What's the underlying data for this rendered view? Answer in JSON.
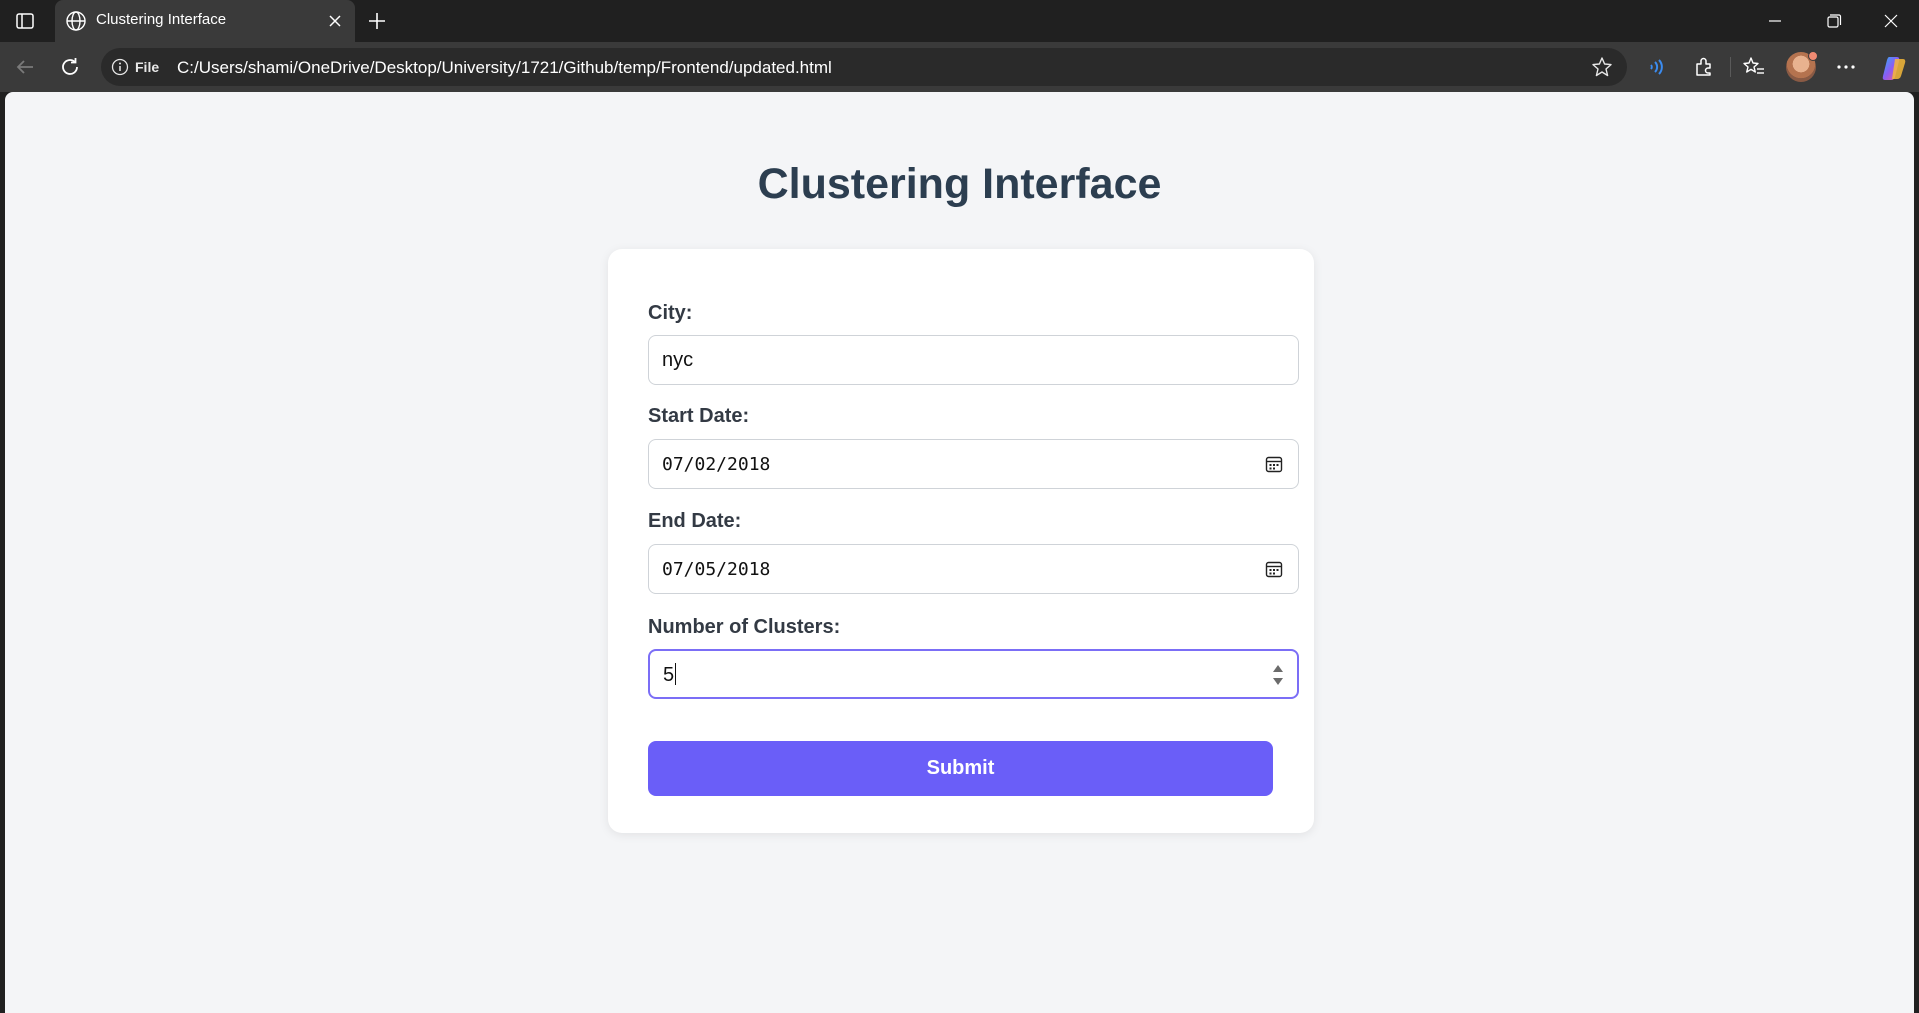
{
  "browser": {
    "tab_title": "Clustering Interface",
    "file_label": "File",
    "url": "C:/Users/shami/OneDrive/Desktop/University/1721/Github/temp/Frontend/updated.html",
    "icons": [
      "sidebar-icon",
      "globe-icon",
      "close-icon",
      "plus-icon",
      "minimize-icon",
      "restore-icon",
      "back-icon",
      "reload-icon",
      "info-icon",
      "star-icon",
      "read-aloud-icon",
      "extensions-icon",
      "favorites-icon",
      "profile-avatar",
      "more-icon",
      "copilot-icon"
    ]
  },
  "page": {
    "title": "Clustering Interface",
    "form": {
      "city_label": "City:",
      "city_value": "nyc",
      "start_date_label": "Start Date:",
      "start_date_value": "07/02/2018",
      "end_date_label": "End Date:",
      "end_date_value": "07/05/2018",
      "clusters_label": "Number of Clusters:",
      "clusters_value": "5",
      "submit_label": "Submit"
    }
  },
  "colors": {
    "accent": "#6a5ef8",
    "title": "#2c3e50",
    "page_bg": "#f4f5f7",
    "chrome_bg": "#202020"
  }
}
